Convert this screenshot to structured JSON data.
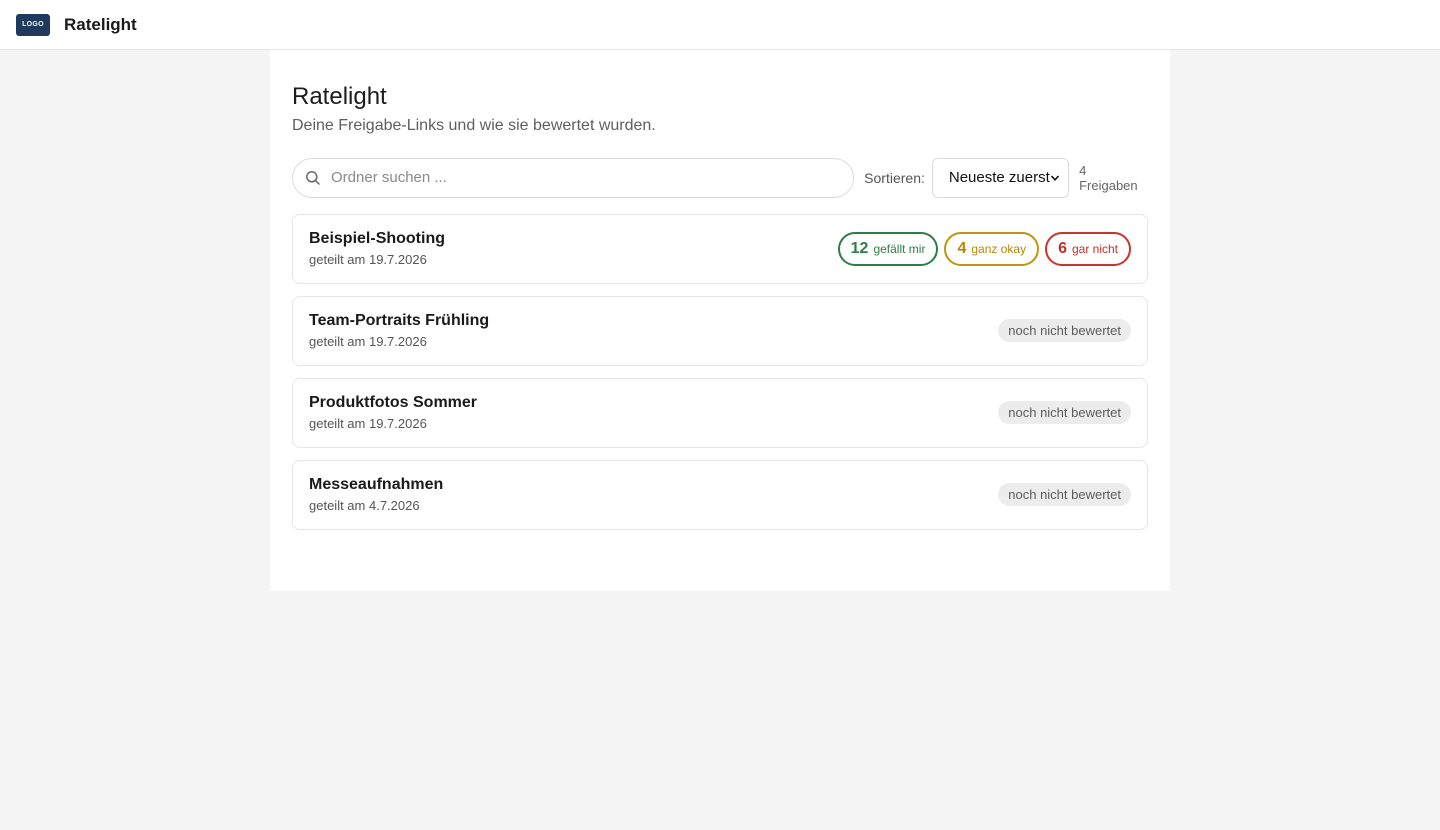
{
  "header": {
    "logo_text": "LOGO",
    "app_name": "Ratelight"
  },
  "page": {
    "title": "Ratelight",
    "subtitle": "Deine Freigabe-Links und wie sie bewertet wurden."
  },
  "toolbar": {
    "search_placeholder": "Ordner suchen ...",
    "sort_label": "Sortieren:",
    "sort_value": "Neueste zuerst",
    "share_count": "4 Freigaben"
  },
  "shares": [
    {
      "title": "Beispiel-Shooting",
      "date": "geteilt am 19.7.2026",
      "ratings": {
        "like": {
          "count": "12",
          "label": "gefällt mir"
        },
        "okay": {
          "count": "4",
          "label": "ganz okay"
        },
        "no": {
          "count": "6",
          "label": "gar nicht"
        }
      }
    },
    {
      "title": "Team-Portraits Frühling",
      "date": "geteilt am 19.7.2026",
      "status": "noch nicht bewertet"
    },
    {
      "title": "Produktfotos Sommer",
      "date": "geteilt am 19.7.2026",
      "status": "noch nicht bewertet"
    },
    {
      "title": "Messeaufnahmen",
      "date": "geteilt am 4.7.2026",
      "status": "noch nicht bewertet"
    }
  ],
  "colors": {
    "like": "#2e7d45",
    "okay": "#c4920c",
    "no": "#c7352c",
    "logo_bg": "#1f3a5c"
  },
  "icons": {
    "search": "search-icon",
    "sort_chevron": "chevron-down-icon"
  }
}
